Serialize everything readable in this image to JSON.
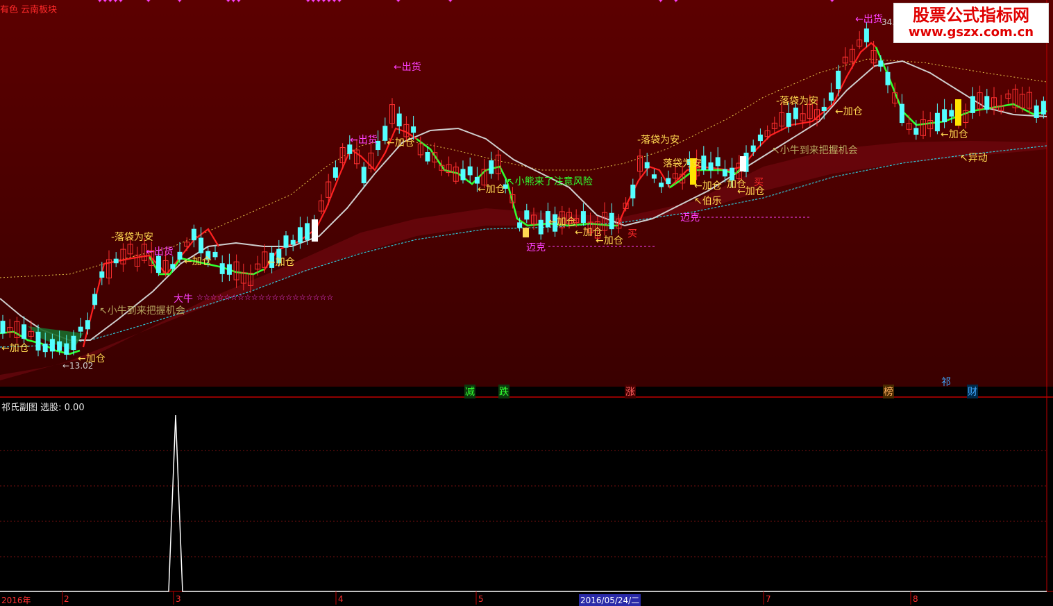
{
  "main_panel": {
    "title": "有色 云南板块",
    "price_labels": {
      "low": "←13.02",
      "high": "34."
    },
    "signals": {
      "luodai": "-落袋为安",
      "luodai2": "落袋为安",
      "chuhuo": "←出货",
      "jiacang": "←加仓",
      "jiacang_short": "加仓",
      "xiaoniu": "↖小牛到来把握机会",
      "xiaoxiong": "↖小熊来了注意风险",
      "daniu": "大牛",
      "stars": "☆☆☆☆☆☆☆☆☆☆☆☆☆☆☆☆☆☆☆☆",
      "maike": "迈克",
      "maike2": "迈克",
      "bole": "↖伯乐",
      "yidong": "↖异动",
      "mai": "买"
    },
    "bottom_markers": [
      "减",
      "跌",
      "涨",
      "榜",
      "祁",
      "财"
    ]
  },
  "sub_panel": {
    "title": "祁氏副图 选股: 0.00"
  },
  "time_axis": {
    "labels": [
      "2016年",
      "2",
      "3",
      "4",
      "5",
      "2016/05/24/二",
      "7",
      "8"
    ]
  },
  "watermark": {
    "line1": "股票公式指标网",
    "line2": "www.gszx.com.cn"
  },
  "colors": {
    "up_candle": "#ff3030",
    "down_candle": "#54ffff",
    "ma_red": "#ff2020",
    "ma_green": "#30ff30",
    "ma_white": "#c8c8c8",
    "dotted_upper": "#e8c84a",
    "dotted_lower": "#30c8d8",
    "signal_yellow": "#ffd850",
    "signal_magenta": "#ff40ff",
    "label_olive": "#b8a860",
    "main_bg_top": "#5a0000",
    "main_bg_bottom": "#3c0000"
  },
  "chart_data": [
    {
      "type": "line",
      "panel": "sub",
      "series": [
        {
          "values": [
            0,
            1,
            0
          ]
        }
      ],
      "note_type": "spike"
    }
  ]
}
